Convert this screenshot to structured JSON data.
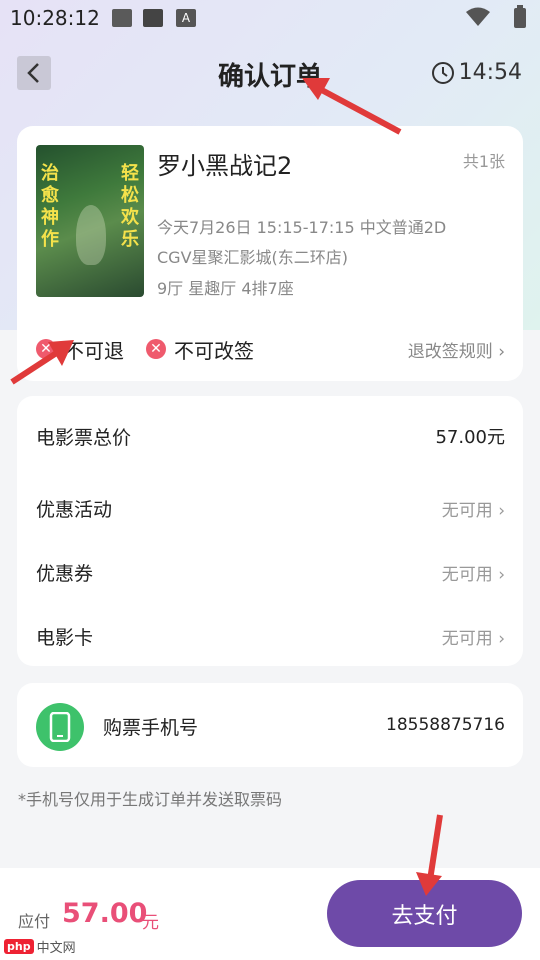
{
  "status_bar": {
    "time": "10:28:12",
    "icons": [
      "image-icon",
      "square-icon",
      "a-icon",
      "wifi-icon",
      "battery-icon"
    ]
  },
  "header": {
    "title": "确认订单",
    "countdown": "14:54"
  },
  "movie": {
    "title": "罗小黑战记2",
    "ticket_count": "共1张",
    "showtime": "今天7月26日 15:15-17:15  中文普通2D",
    "cinema": "CGV星聚汇影城(东二环店)",
    "seat": "9厅 星趣厅 4排7座",
    "poster_text_left": "治愈神作",
    "poster_text_right": "轻松欢乐",
    "policies": [
      "不可退",
      "不可改签"
    ],
    "rules_link": "退改签规则"
  },
  "price": {
    "rows": [
      {
        "label": "电影票总价",
        "value": "57.00元"
      },
      {
        "label": "优惠活动",
        "value": "无可用"
      },
      {
        "label": "优惠券",
        "value": "无可用"
      },
      {
        "label": "电影卡",
        "value": "无可用"
      }
    ]
  },
  "phone": {
    "label": "购票手机号",
    "value": "18558875716"
  },
  "note": "*手机号仅用于生成订单并发送取票码",
  "bottom": {
    "pay_label": "应付",
    "amount": "57.00",
    "unit": "元",
    "pay_button": "去支付"
  },
  "watermark": {
    "logo": "php",
    "text": "中文网"
  },
  "colors": {
    "accent": "#6e4aa8",
    "price": "#e94f78",
    "annotation_arrow": "#e03a3a",
    "phone_icon": "#3ec26b"
  }
}
